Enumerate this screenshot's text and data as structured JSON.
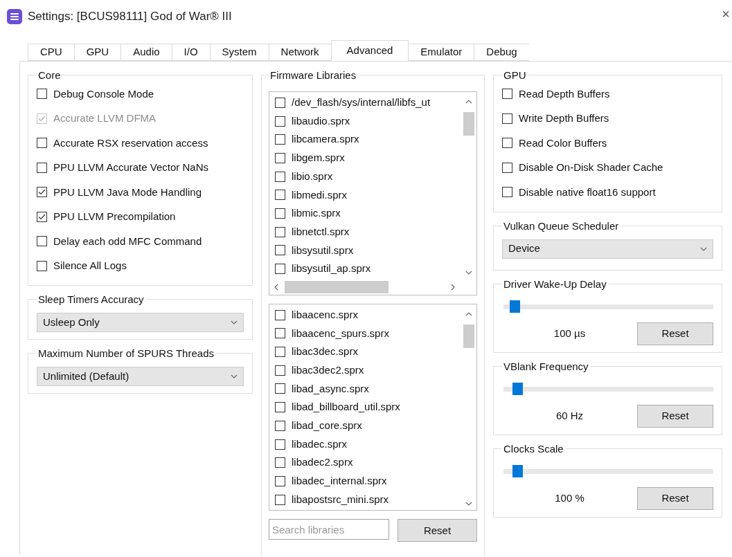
{
  "window": {
    "title": "Settings: [BCUS98111] God of War® III",
    "close": "×"
  },
  "tabs": [
    {
      "label": "CPU",
      "selected": false
    },
    {
      "label": "GPU",
      "selected": false
    },
    {
      "label": "Audio",
      "selected": false
    },
    {
      "label": "I/O",
      "selected": false
    },
    {
      "label": "System",
      "selected": false
    },
    {
      "label": "Network",
      "selected": false
    },
    {
      "label": "Advanced",
      "selected": true
    },
    {
      "label": "Emulator",
      "selected": false
    },
    {
      "label": "Debug",
      "selected": false
    }
  ],
  "core": {
    "title": "Core",
    "options": [
      {
        "label": "Debug Console Mode",
        "checked": false,
        "disabled": false
      },
      {
        "label": "Accurate LLVM DFMA",
        "checked": true,
        "disabled": true
      },
      {
        "label": "Accurate RSX reservation access",
        "checked": false,
        "disabled": false
      },
      {
        "label": "PPU LLVM Accurate Vector NaNs",
        "checked": false,
        "disabled": false
      },
      {
        "label": "PPU LLVM Java Mode Handling",
        "checked": true,
        "disabled": false
      },
      {
        "label": "PPU LLVM Precompilation",
        "checked": true,
        "disabled": false
      },
      {
        "label": "Delay each odd MFC Command",
        "checked": false,
        "disabled": false
      },
      {
        "label": "Silence All Logs",
        "checked": false,
        "disabled": false
      }
    ]
  },
  "sleep_timers": {
    "title": "Sleep Timers Accuracy",
    "value": "Usleep Only"
  },
  "spurs_threads": {
    "title": "Maximum Number of SPURS Threads",
    "value": "Unlimited (Default)"
  },
  "firmware": {
    "title": "Firmware Libraries",
    "lists": [
      {
        "horizontal_scroll": true,
        "items": [
          {
            "label": "/dev_flash/sys/internal/libfs_ut",
            "checked": false
          },
          {
            "label": "libaudio.sprx",
            "checked": false
          },
          {
            "label": "libcamera.sprx",
            "checked": false
          },
          {
            "label": "libgem.sprx",
            "checked": false
          },
          {
            "label": "libio.sprx",
            "checked": false
          },
          {
            "label": "libmedi.sprx",
            "checked": false
          },
          {
            "label": "libmic.sprx",
            "checked": false
          },
          {
            "label": "libnetctl.sprx",
            "checked": false
          },
          {
            "label": "libsysutil.sprx",
            "checked": false
          },
          {
            "label": "libsysutil_ap.sprx",
            "checked": false
          }
        ]
      },
      {
        "horizontal_scroll": false,
        "items": [
          {
            "label": "libaacenc.sprx",
            "checked": false
          },
          {
            "label": "libaacenc_spurs.sprx",
            "checked": false
          },
          {
            "label": "libac3dec.sprx",
            "checked": false
          },
          {
            "label": "libac3dec2.sprx",
            "checked": false
          },
          {
            "label": "libad_async.sprx",
            "checked": false
          },
          {
            "label": "libad_billboard_util.sprx",
            "checked": false
          },
          {
            "label": "libad_core.sprx",
            "checked": false
          },
          {
            "label": "libadec.sprx",
            "checked": false
          },
          {
            "label": "libadec2.sprx",
            "checked": false
          },
          {
            "label": "libadec_internal.sprx",
            "checked": false
          },
          {
            "label": "libapostsrc_mini.sprx",
            "checked": false
          }
        ]
      }
    ],
    "search": {
      "placeholder": "Search libraries"
    },
    "reset": "Reset"
  },
  "gpu": {
    "title": "GPU",
    "options": [
      {
        "label": "Read Depth Buffers",
        "checked": false
      },
      {
        "label": "Write Depth Buffers",
        "checked": false
      },
      {
        "label": "Read Color Buffers",
        "checked": false
      },
      {
        "label": "Disable On-Disk Shader Cache",
        "checked": false
      },
      {
        "label": "Disable native float16 support",
        "checked": false
      }
    ]
  },
  "vulkan": {
    "title": "Vulkan Queue Scheduler",
    "value": "Device"
  },
  "sliders": [
    {
      "title": "Driver Wake-Up Delay",
      "level": 0.03,
      "reading": "100 µs",
      "reset": "Reset"
    },
    {
      "title": "VBlank Frequency",
      "level": 0.045,
      "reading": "60 Hz",
      "reset": "Reset"
    },
    {
      "title": "Clocks Scale",
      "level": 0.045,
      "reading": "100 %",
      "reset": "Reset"
    }
  ]
}
